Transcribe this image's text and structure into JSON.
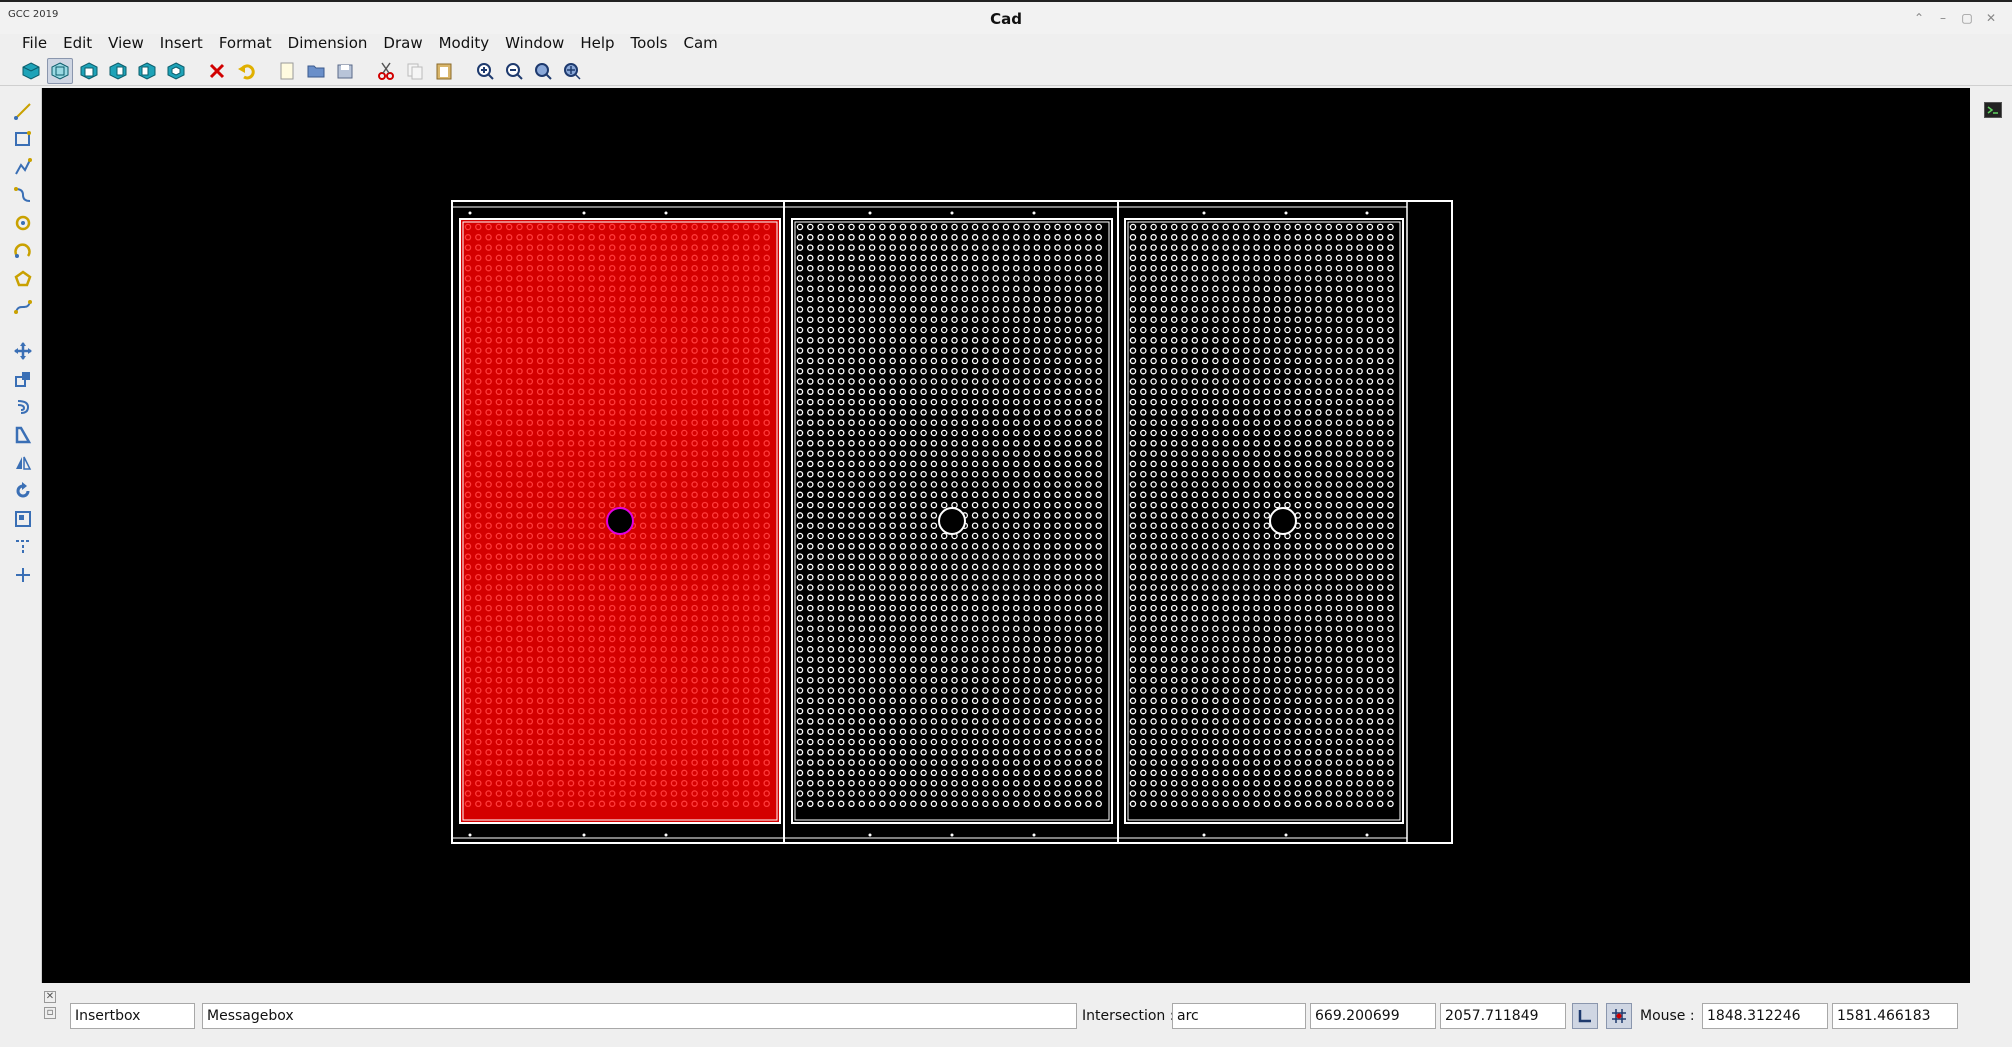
{
  "window": {
    "title": "Cad",
    "logo_text": "GCC 2019",
    "buttons": [
      "up-icon",
      "minimize-icon",
      "maximize-icon",
      "close-icon"
    ]
  },
  "menu": [
    "File",
    "Edit",
    "View",
    "Insert",
    "Format",
    "Dimension",
    "Draw",
    "Modity",
    "Window",
    "Help",
    "Tools",
    "Cam"
  ],
  "toolbar": {
    "view_icons": [
      "view-3d-icon",
      "view-top-icon",
      "view-front-icon",
      "view-right-icon",
      "view-left-icon",
      "view-iso-icon"
    ],
    "active_view": "view-top-icon",
    "edit_icons": [
      "delete-icon",
      "undo-icon"
    ],
    "file_icons": [
      "new-file-icon",
      "open-folder-icon",
      "save-icon"
    ],
    "clipboard_icons": [
      "cut-icon",
      "copy-icon",
      "paste-icon"
    ],
    "zoom_icons": [
      "zoom-in-icon",
      "zoom-out-icon",
      "zoom-fit-icon",
      "zoom-all-icon"
    ]
  },
  "left_tools": [
    "line-icon",
    "rectangle-icon",
    "polyline-icon",
    "spline-icon",
    "circle-icon",
    "arc-icon",
    "polygon-icon",
    "curve-icon",
    "move-icon",
    "copy-objects-icon",
    "offset-icon",
    "scale-icon",
    "mirror-icon",
    "rotate-icon",
    "array-icon",
    "trim-icon",
    "extend-icon"
  ],
  "drawing": {
    "background": "#000000",
    "panels": 3,
    "highlight_color": "#d40000",
    "selected_marker_color": "#e000e0",
    "line_color": "#ffffff"
  },
  "status": {
    "insertbox": "Insertbox",
    "messagebox": "Messagebox",
    "intersection_label": "Intersection :",
    "intersection_value": "arc",
    "coord_x": "669.200699",
    "coord_y": "2057.711849",
    "mouse_label": "Mouse :",
    "mouse_x": "1848.312246",
    "mouse_y": "1581.466183"
  }
}
